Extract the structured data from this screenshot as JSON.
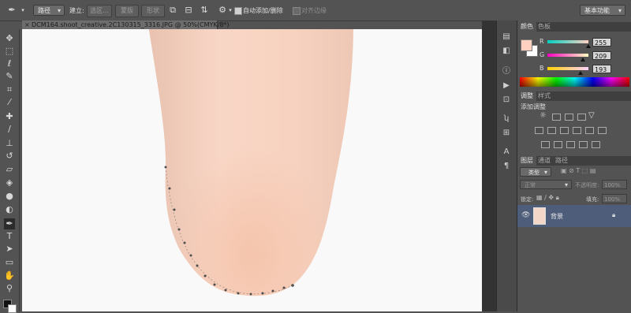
{
  "options_bar": {
    "mode_select": "路径",
    "make_label": "建立:",
    "selection_btn": "选区...",
    "mask_btn": "蒙版",
    "shape_btn": "形状",
    "auto_add_delete_label": "自动添加/删除",
    "align_edges_label": "对齐边缘",
    "workspace_select": "基本功能"
  },
  "document": {
    "tab_title": "DCM164.shoot_creative.2C130315_3316.JPG @ 50%(CMYK/8*)",
    "close_glyph": "×"
  },
  "color_panel": {
    "tabs": [
      "颜色",
      "色板"
    ],
    "active_tab": 0,
    "r_label": "R",
    "r_value": "255",
    "g_label": "G",
    "g_value": "209",
    "b_label": "B",
    "b_value": "193",
    "foreground": "#ffd1c1",
    "background": "#ffffff"
  },
  "adjust_panel": {
    "tabs": [
      "调整",
      "样式"
    ],
    "active_tab": 0,
    "heading": "添加调整"
  },
  "layers_panel": {
    "tabs": [
      "图层",
      "通道",
      "路径"
    ],
    "active_tab": 0,
    "filter_kind": "类型",
    "blend_mode": "正常",
    "opacity_label": "不透明度:",
    "opacity_value": "100%",
    "lock_label": "锁定:",
    "fill_label": "填充:",
    "fill_value": "100%",
    "layers": [
      {
        "name": "背景",
        "visible": true,
        "locked": true
      }
    ]
  },
  "colors": {
    "ui_bg": "#535353",
    "panel_dark": "#3f3f3f",
    "layer_selected": "#4e5d7a",
    "canvas_bg": "#f9f9f9",
    "skin": "#f6cdb9"
  },
  "tools": [
    "move-tool",
    "marquee-tool",
    "lasso-tool",
    "quick-select-tool",
    "crop-tool",
    "eyedropper-tool",
    "healing-brush-tool",
    "brush-tool",
    "clone-stamp-tool",
    "history-brush-tool",
    "eraser-tool",
    "paint-bucket-tool",
    "blur-tool",
    "dodge-tool",
    "pen-tool",
    "type-tool",
    "path-select-tool",
    "rectangle-tool",
    "hand-tool",
    "zoom-tool"
  ]
}
